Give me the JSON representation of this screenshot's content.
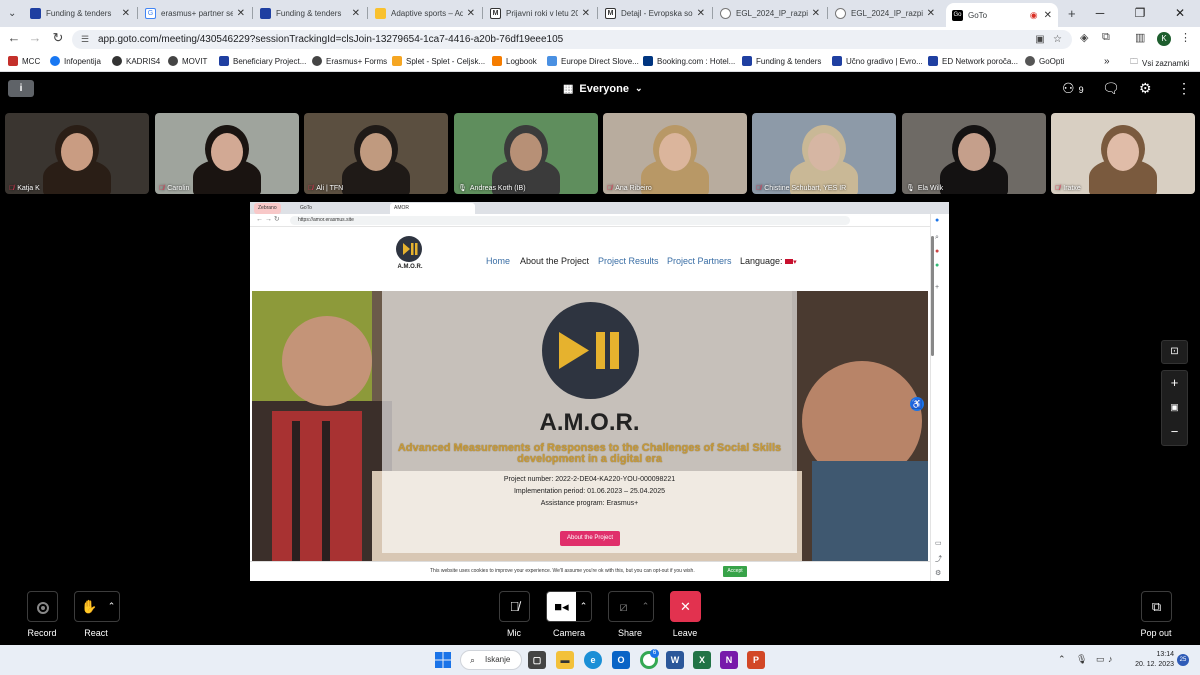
{
  "browser": {
    "tabs": [
      {
        "title": "Funding & tenders",
        "color": "#1f3fa1"
      },
      {
        "title": "erasmus+ partner sea",
        "color": "#4285f4"
      },
      {
        "title": "Funding & tenders",
        "color": "#1f3fa1"
      },
      {
        "title": "Adaptive sports – Ada",
        "color": "#f9c12e"
      },
      {
        "title": "Prijavni roki v letu 20",
        "color": "#3b3b3b"
      },
      {
        "title": "Detajl - Evropska solid",
        "color": "#3b3b3b"
      },
      {
        "title": "EGL_2024_IP_razpis_",
        "color": "#7a7a7a"
      },
      {
        "title": "EGL_2024_IP_razpis_",
        "color": "#7a7a7a"
      },
      {
        "title": "GoTo",
        "color": "#000000"
      }
    ],
    "url": "app.goto.com/meeting/430546229?sessionTrackingId=clsJoin-13279654-1ca7-4416-a20b-76df19eee105",
    "profile_initial": "K",
    "bookmarks": [
      {
        "label": "MCC",
        "color": "#c4302b"
      },
      {
        "label": "Infopentija",
        "color": "#1877f2"
      },
      {
        "label": "KADRIS4",
        "color": "#333333"
      },
      {
        "label": "MOVIT",
        "color": "#444444"
      },
      {
        "label": "Beneficiary Project...",
        "color": "#1f3fa1"
      },
      {
        "label": "Erasmus+ Forms",
        "color": "#444444"
      },
      {
        "label": "Splet - Splet - Celjsk...",
        "color": "#f5a623"
      },
      {
        "label": "Logbook",
        "color": "#f57c00"
      },
      {
        "label": "Europe Direct Slove...",
        "color": "#4a90e2"
      },
      {
        "label": "Booking.com : Hotel...",
        "color": "#003580"
      },
      {
        "label": "Funding & tenders",
        "color": "#1f3fa1"
      },
      {
        "label": "Učno gradivo | Evro...",
        "color": "#1f3fa1"
      },
      {
        "label": "ED Network poroča...",
        "color": "#1f3fa1"
      },
      {
        "label": "GoOpti",
        "color": "#555555"
      }
    ],
    "all_bookmarks": "Vsi zaznamki"
  },
  "meeting": {
    "audience": "Everyone",
    "participant_count": "9",
    "participants": [
      {
        "name": "Katja K",
        "muted": true,
        "bg": "#3a3530",
        "skin": "#c99c82",
        "hair": "#2a1e16"
      },
      {
        "name": "Carolin",
        "muted": true,
        "bg": "#9fa49d",
        "skin": "#d2a994",
        "hair": "#1a1411"
      },
      {
        "name": "Ali | TFN",
        "muted": true,
        "bg": "#5b4f40",
        "skin": "#c09a7f",
        "hair": "#1f1a17"
      },
      {
        "name": "Andreas Koth (IB)",
        "muted": false,
        "bg": "#5f8e5d",
        "skin": "#b79076",
        "hair": "#3b3b3b"
      },
      {
        "name": "Ana Ribeiro",
        "muted": true,
        "bg": "#b8ac9e",
        "skin": "#dbb59c",
        "hair": "#b89866"
      },
      {
        "name": "Chistine Schubart, YES IR",
        "muted": true,
        "bg": "#8d9aa8",
        "skin": "#d6b6a3",
        "hair": "#c9b896"
      },
      {
        "name": "Ela Wilk",
        "muted": false,
        "bg": "#6e6a65",
        "skin": "#c59f8b",
        "hair": "#141212"
      },
      {
        "name": "Iratxe",
        "muted": true,
        "bg": "#d8cfc2",
        "skin": "#e0bca8",
        "hair": "#7a5a3e"
      }
    ]
  },
  "shared": {
    "tabs": [
      "Zebrano",
      "GoTo",
      "AMOR"
    ],
    "url": "https://amor.erasmus.site",
    "site": {
      "logo_text": "A.M.O.R.",
      "nav": [
        {
          "label": "Home",
          "color": "#3a6ea5"
        },
        {
          "label": "About the Project",
          "color": "#222222"
        },
        {
          "label": "Project Results",
          "color": "#3a6ea5"
        },
        {
          "label": "Project Partners",
          "color": "#3a6ea5"
        },
        {
          "label": "Language:",
          "color": "#222222"
        }
      ],
      "hero_title": "A.M.O.R.",
      "tagline": "Advanced Measurements of Responses to the Challenges of Social Skills development in a digital era",
      "project_number": "Project number: 2022-2-DE04-KA220-YOU-000098221",
      "implementation_period": "Implementation period: 01.06.2023 – 25.04.2025",
      "assistance_program": "Assistance program: Erasmus+",
      "about_button": "About the Project",
      "cookie_text": "This website uses cookies to improve your experience. We'll assume you're ok with this, but you can opt-out if you wish.",
      "accept": "Accept"
    }
  },
  "controls": {
    "record": "Record",
    "react": "React",
    "mic": "Mic",
    "camera": "Camera",
    "share": "Share",
    "leave": "Leave",
    "pop_out": "Pop out"
  },
  "taskbar": {
    "search": "Iskanje",
    "time": "13:14",
    "date": "20. 12. 2023",
    "notifications": "25",
    "chrome_badge": "6"
  },
  "colors": {
    "leave": "#e2324f",
    "accent": "#e02f6b",
    "gold": "#c69a3a"
  }
}
